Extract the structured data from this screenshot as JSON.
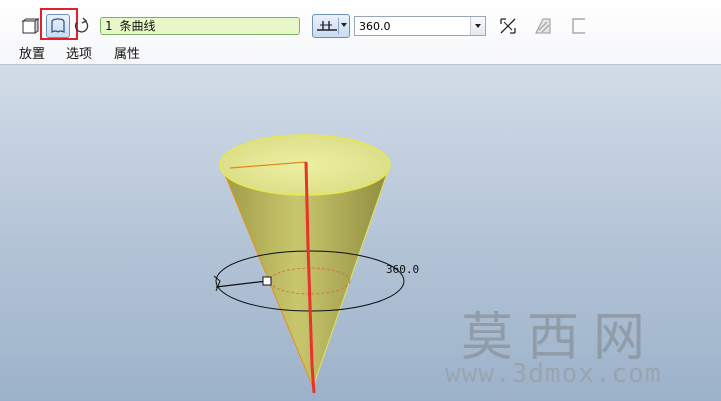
{
  "dashboard": {
    "collector_text": "1 条曲线",
    "angle_value": "360.0",
    "tabs": [
      {
        "label": "放置"
      },
      {
        "label": "选项"
      },
      {
        "label": "属性"
      }
    ],
    "icons": {
      "solid": "solid-icon",
      "surface": "surface-icon",
      "flip": "flip-side-icon",
      "angle_type": "angle-from-sketch-icon",
      "flip_direction": "flip-direction-icon",
      "thicken": "thicken-icon",
      "remove_material": "remove-material-icon"
    },
    "highlight_color": "#e0202a"
  },
  "viewport": {
    "angle_annotation": "360.0",
    "model_color": "#c8c86a",
    "axis_color": "#e8322a"
  },
  "watermark": {
    "logo": "莫西网",
    "url": "www.3dmox.com"
  }
}
